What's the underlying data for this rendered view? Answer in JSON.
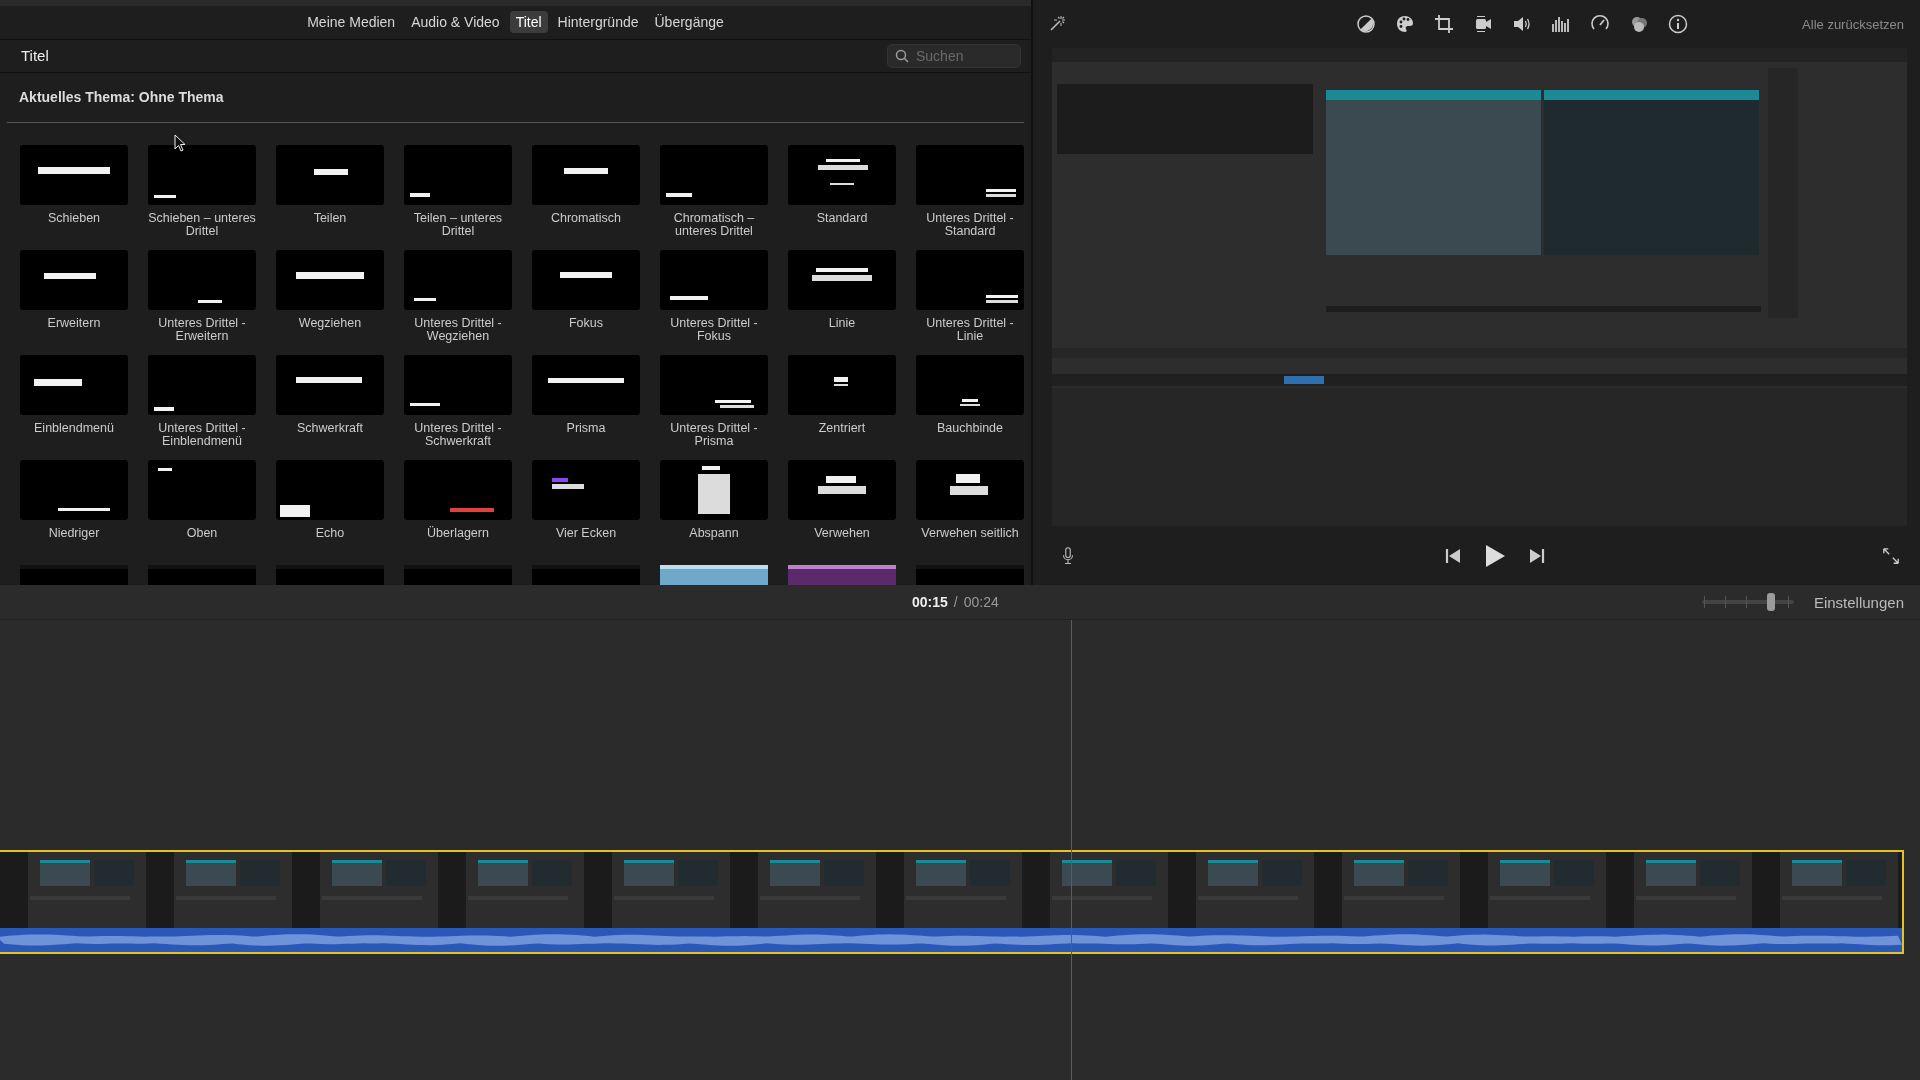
{
  "library_tabs": [
    {
      "label": "Meine Medien",
      "selected": false
    },
    {
      "label": "Audio & Video",
      "selected": false
    },
    {
      "label": "Titel",
      "selected": true
    },
    {
      "label": "Hintergründe",
      "selected": false
    },
    {
      "label": "Übergänge",
      "selected": false
    }
  ],
  "browser": {
    "title": "Titel",
    "search": {
      "placeholder": "Suchen"
    },
    "theme_heading": "Aktuelles Thema: Ohne Thema",
    "titles": [
      {
        "label": "Schieben"
      },
      {
        "label": "Schieben – unteres Drittel"
      },
      {
        "label": "Teilen"
      },
      {
        "label": "Teilen – unteres Drittel"
      },
      {
        "label": "Chromatisch"
      },
      {
        "label": "Chromatisch – unteres Drittel"
      },
      {
        "label": "Standard"
      },
      {
        "label": "Unteres Drittel - Standard"
      },
      {
        "label": "Erweitern"
      },
      {
        "label": "Unteres Drittel - Erweitern"
      },
      {
        "label": "Wegziehen"
      },
      {
        "label": "Unteres Drittel - Wegziehen"
      },
      {
        "label": "Fokus"
      },
      {
        "label": "Unteres Drittel - Fokus"
      },
      {
        "label": "Linie"
      },
      {
        "label": "Unteres Drittel - Linie"
      },
      {
        "label": "Einblendmenü"
      },
      {
        "label": "Unteres Drittel - Einblendmenü"
      },
      {
        "label": "Schwerkraft"
      },
      {
        "label": "Unteres Drittel - Schwerkraft"
      },
      {
        "label": "Prisma"
      },
      {
        "label": "Unteres Drittel - Prisma"
      },
      {
        "label": "Zentriert"
      },
      {
        "label": "Bauchbinde"
      },
      {
        "label": "Niedriger"
      },
      {
        "label": "Oben"
      },
      {
        "label": "Echo"
      },
      {
        "label": "Überlagern"
      },
      {
        "label": "Vier Ecken"
      },
      {
        "label": "Abspann"
      },
      {
        "label": "Verwehen"
      },
      {
        "label": "Verwehen seitlich"
      }
    ]
  },
  "viewer": {
    "reset_button": "Alle zurücksetzen"
  },
  "timeline": {
    "current_time": "00:15",
    "separator": "/",
    "duration": "00:24",
    "zoom": {
      "level": 0.75
    },
    "settings_button": "Einstellungen"
  }
}
